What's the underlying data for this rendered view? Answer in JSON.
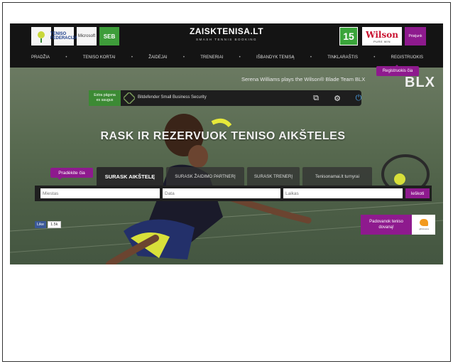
{
  "header": {
    "sponsors": [
      "",
      "TENISO FEDERACIJA",
      "Microsoft",
      "SEB"
    ],
    "site_title": "ZAISKTENISA.LT",
    "site_tagline": "SMASH TENNIS BOOKING",
    "badge": "15",
    "wilson_brand": "Wilson",
    "wilson_tagline": "PURE WIN",
    "login_label": "Prisijunk"
  },
  "nav": {
    "items": [
      "PRADŽIA",
      "TENISO KORTAI",
      "ŽAIDĖJAI",
      "TRENERIAI",
      "IŠBANDYK TENISĄ",
      "TINKLARAŠTIS",
      "REGISTRUOKIS"
    ],
    "separator": "•"
  },
  "hero": {
    "register_tip": "Registruokis čia",
    "promo_text": "Serena Williams plays the Wilson® Blade Team BLX",
    "promo_brand": "BLX",
    "extra_protection": "Extra pāgsna\nes saugus",
    "ad_text": "Bitdefender Small Business Security",
    "headline": "RASK IR REZERVUOK TENISO AIKŠTELES",
    "start_tip": "Pradėkite čia",
    "tabs": [
      "SURASK AIKŠTELĘ",
      "SURASK ŽAIDIMO PARTNERĮ",
      "SURASK TRENERĮ",
      "Tenisonamai.lt turnyrai"
    ],
    "search": {
      "city_placeholder": "Miestas",
      "date_placeholder": "Data",
      "time_placeholder": "Laikas",
      "search_label": "Ieškoti"
    },
    "fb_like": "Like",
    "fb_count": "1.5k",
    "gift_text": "Padovanok teniso\ndovaną!",
    "gift_brand": "giftdovana"
  },
  "colors": {
    "accent_purple": "#8e1a8e",
    "green": "#3c8a34",
    "header_bg": "#141414"
  }
}
